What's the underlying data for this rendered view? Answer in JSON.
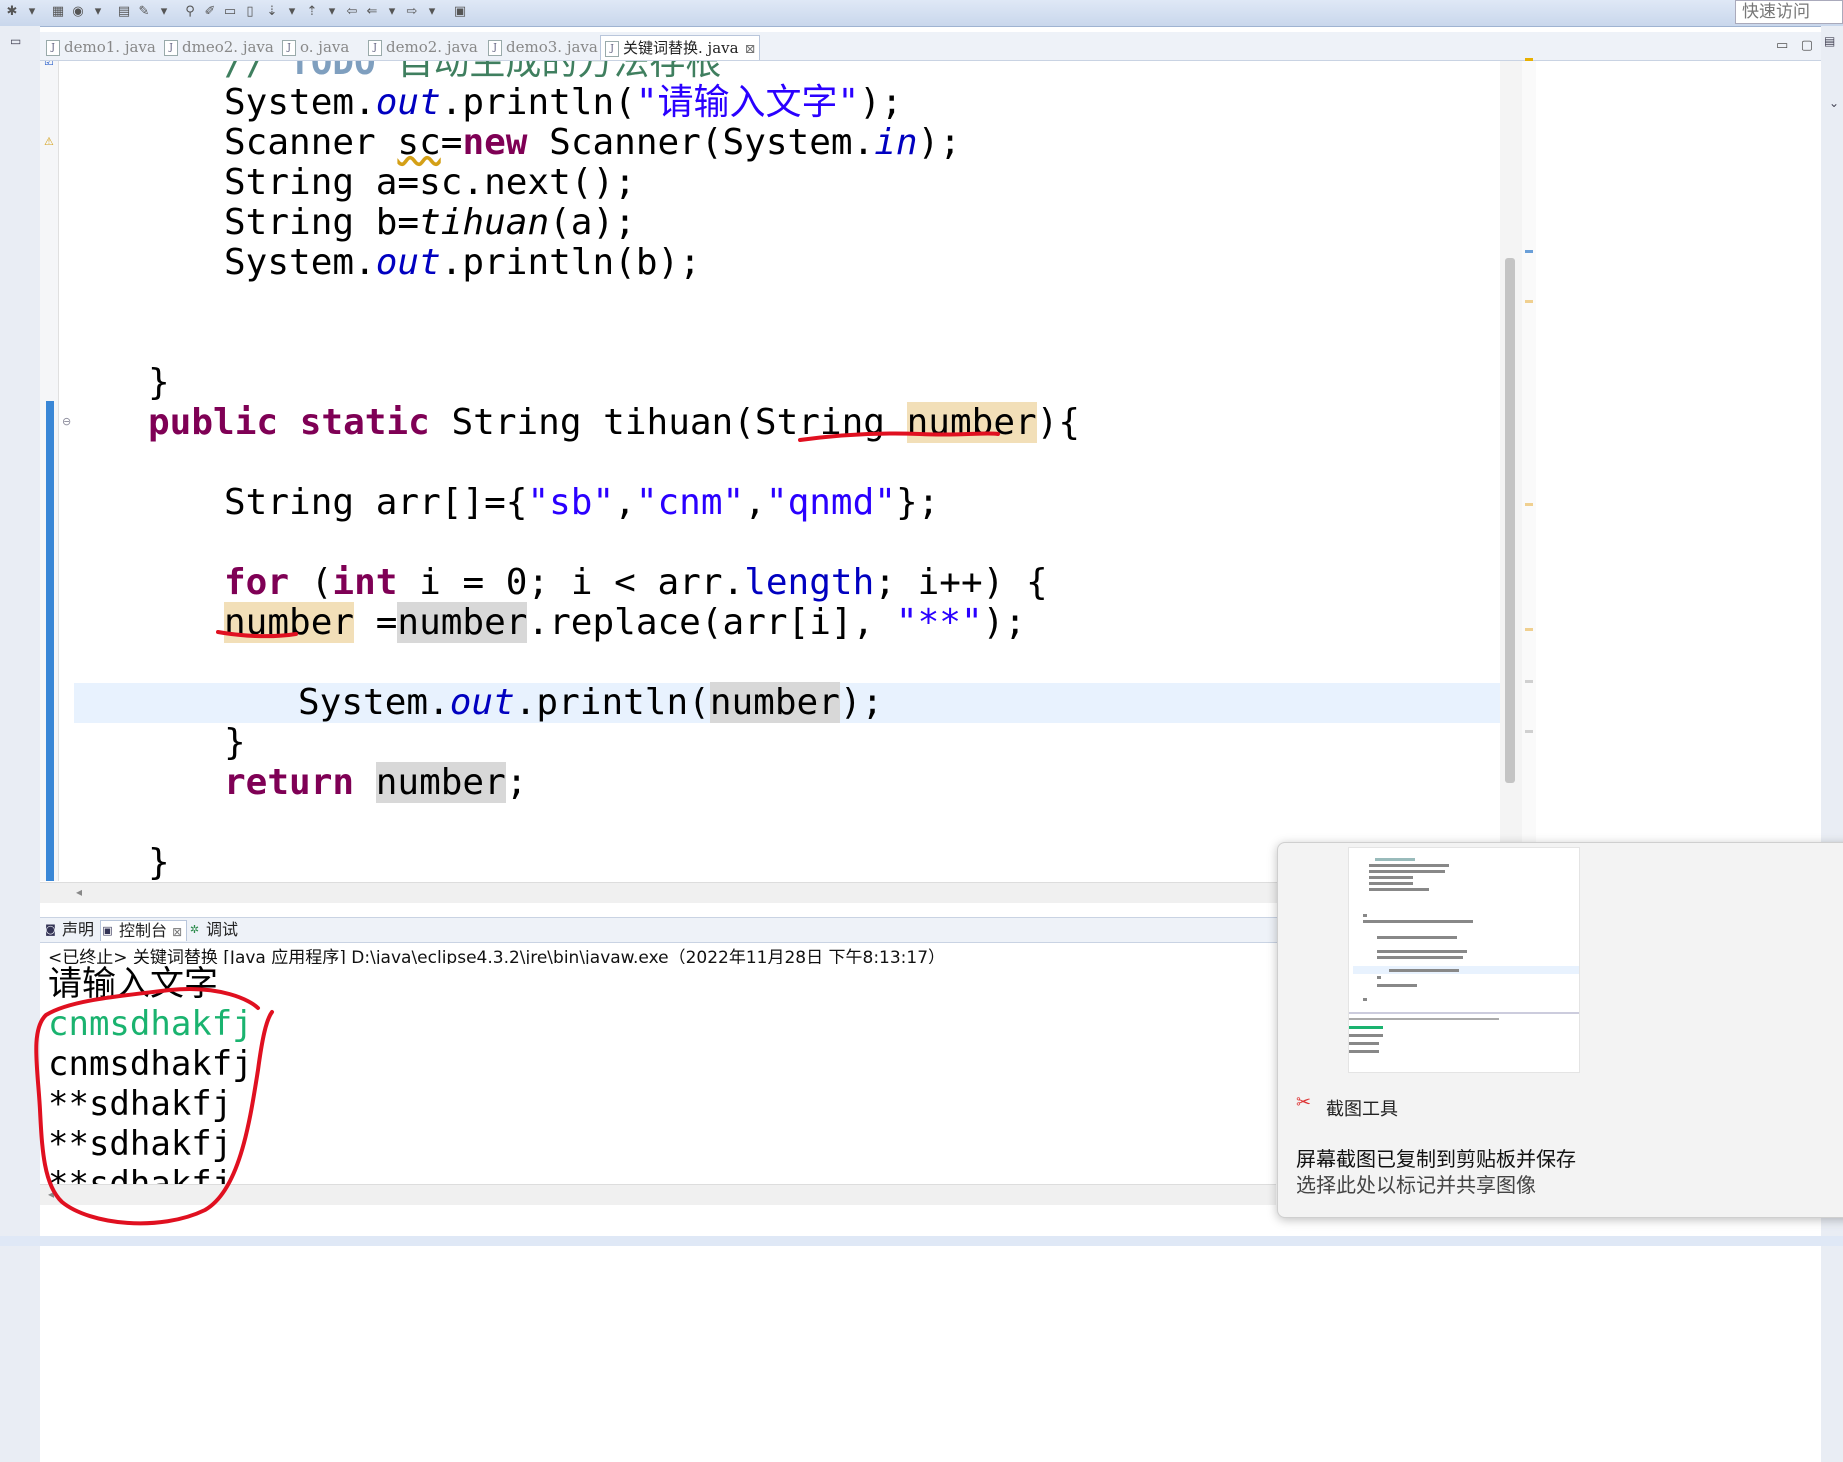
{
  "toolbar": {
    "quick_access": "快速访问"
  },
  "editor_tabs": [
    {
      "label": "demo1. java"
    },
    {
      "label": "dmeo2. java"
    },
    {
      "label": "o. java"
    },
    {
      "label": "demo2. java"
    },
    {
      "label": "demo3. java"
    },
    {
      "label": "关键词替换. java",
      "active": true
    }
  ],
  "code": {
    "l1_comment": "// ",
    "l1_todo": "TODO",
    "l1_rest": " 自动生成的方法存根",
    "l2": [
      "System.",
      "out",
      ".println(",
      "\"请输入文字\"",
      ");"
    ],
    "l3": [
      "Scanner ",
      "sc",
      "=",
      "new",
      " Scanner(System.",
      "in",
      ");"
    ],
    "l4": "String a=sc.next();",
    "l5": [
      "String b=",
      "tihuan",
      "(a);"
    ],
    "l6": [
      "System.",
      "out",
      ".println(b);"
    ],
    "l7": "}",
    "l8": [
      "public",
      "static",
      "String tihuan(String ",
      "number",
      "){"
    ],
    "l9": [
      "String arr[]={",
      "\"sb\"",
      ",",
      "\"cnm\"",
      ",",
      "\"qnmd\"",
      "};"
    ],
    "l10": [
      "for",
      " (",
      "int",
      " i = 0; i < arr.",
      "length",
      "; i++) {"
    ],
    "l11": [
      "number",
      " =",
      "number",
      ".replace(arr[i], ",
      "\"**\"",
      ");"
    ],
    "l12": [
      "System.",
      "out",
      ".println(",
      "number",
      ");"
    ],
    "l13": "}",
    "l14": [
      "return",
      "number",
      ";"
    ],
    "l15": "}"
  },
  "console": {
    "tabs": [
      {
        "label": "声明"
      },
      {
        "label": "控制台",
        "active": true
      },
      {
        "label": "调试"
      }
    ],
    "status": "<已终止> 关键词替换 [Java 应用程序] D:\\java\\eclipse4.3.2\\jre\\bin\\javaw.exe（2022年11月28日 下午8:13:17）",
    "lines": [
      {
        "text": "请输入文字",
        "kind": "prompt"
      },
      {
        "text": "cnmsdhakfj",
        "kind": "user"
      },
      {
        "text": "cnmsdhakfj",
        "kind": "out"
      },
      {
        "text": "**sdhakfj",
        "kind": "out"
      },
      {
        "text": "**sdhakfj",
        "kind": "out"
      },
      {
        "text": "**sdhakfj",
        "kind": "out"
      }
    ]
  },
  "snip": {
    "title": "截图工具",
    "message": "屏幕截图已复制到剪贴板并保存",
    "hint": "选择此处以标记并共享图像"
  },
  "colors": {
    "keyword": "#7f0055",
    "string": "#2a00ff",
    "field": "#0000c0",
    "comment": "#3f7f5f",
    "console_input": "#1ab36f",
    "annotation": "#e01020"
  }
}
